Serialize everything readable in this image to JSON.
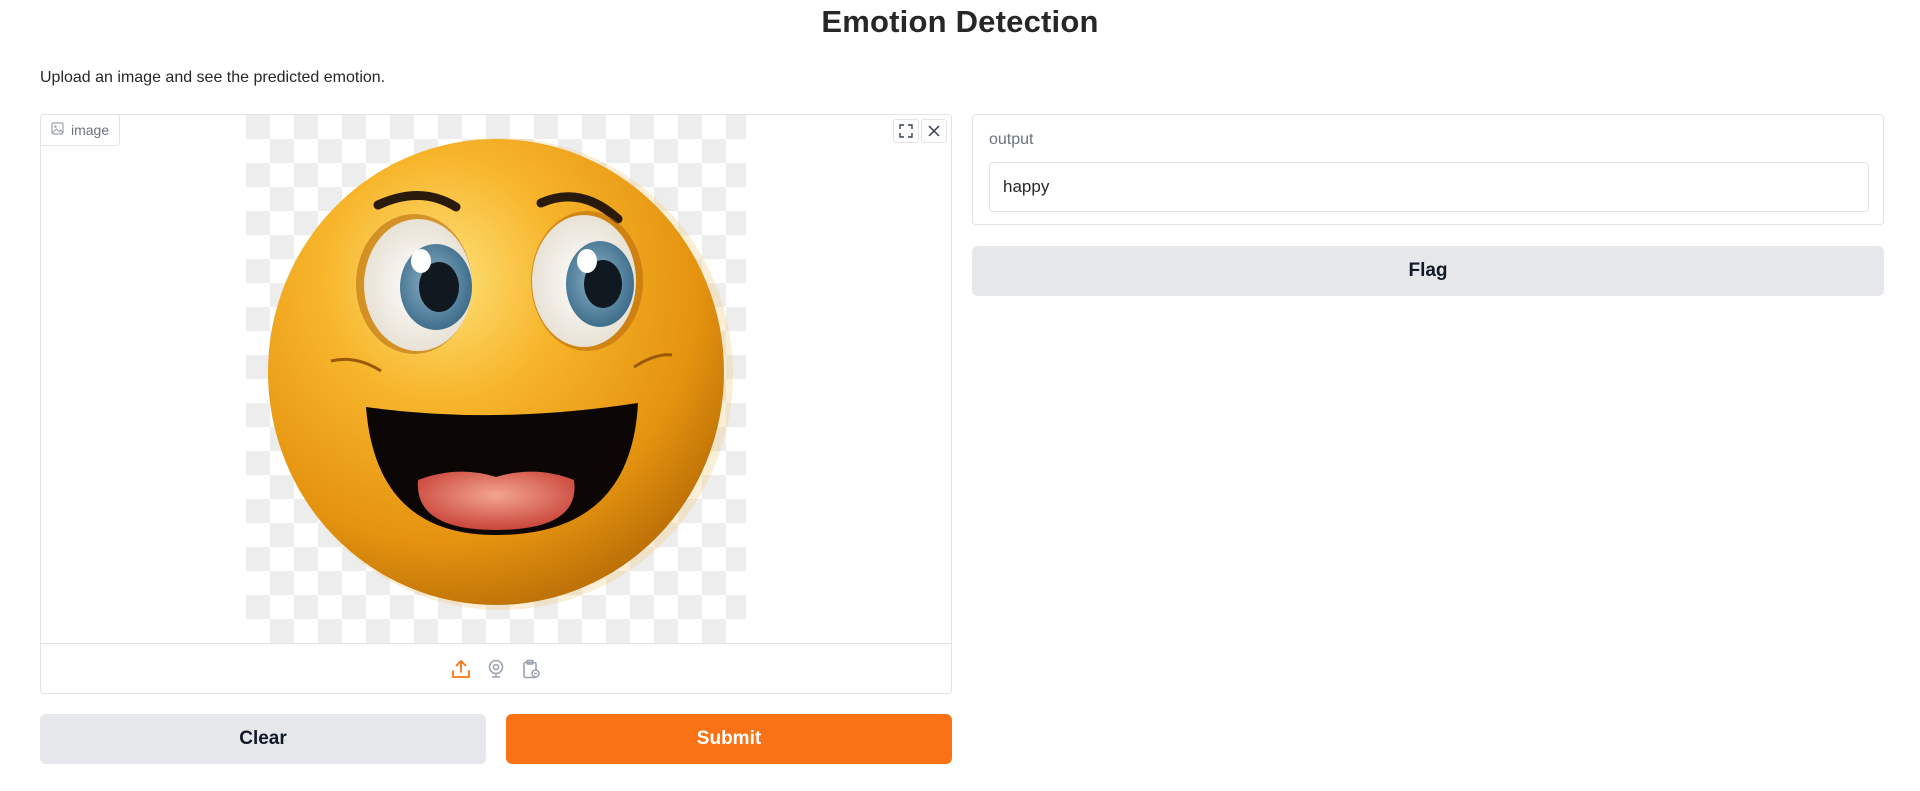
{
  "page": {
    "title": "Emotion Detection",
    "description": "Upload an image and see the predicted emotion."
  },
  "image_input": {
    "label": "image",
    "label_icon": "image-icon",
    "top_actions": [
      "fullscreen-icon",
      "close-icon"
    ],
    "sources": [
      "upload-icon",
      "webcam-icon",
      "clipboard-icon"
    ],
    "active_source": "upload",
    "preview": "smiling emoji face"
  },
  "output": {
    "label": "output",
    "value": "happy"
  },
  "buttons": {
    "clear": "Clear",
    "submit": "Submit",
    "flag": "Flag"
  },
  "colors": {
    "accent": "#f97316",
    "secondary_button": "#e5e7eb",
    "border": "#e4e4e7",
    "muted_text": "#6b7280"
  }
}
